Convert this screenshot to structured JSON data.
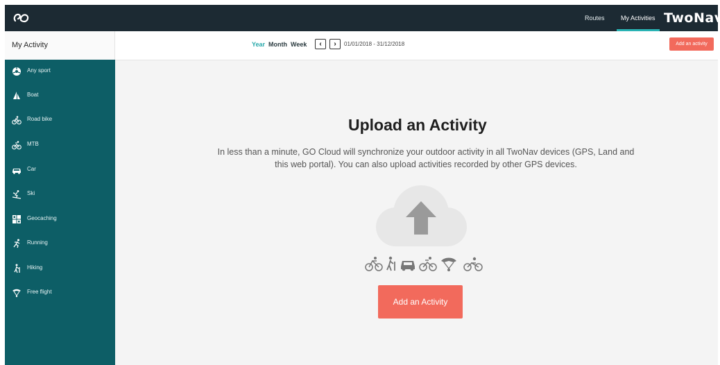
{
  "header": {
    "nav": [
      {
        "label": "Routes",
        "active": false
      },
      {
        "label": "My Activities",
        "active": true
      }
    ],
    "brand": "TwoNav",
    "logo_icon": "go-logo-icon"
  },
  "subheader": {
    "title": "My Activity",
    "periods": [
      {
        "label": "Year",
        "active": true
      },
      {
        "label": "Month",
        "active": false
      },
      {
        "label": "Week",
        "active": false
      }
    ],
    "prev_icon": "chevron-left-icon",
    "next_icon": "chevron-right-icon",
    "date_range": "01/01/2018 - 31/12/2018",
    "add_button": "Add an activity"
  },
  "sidebar": {
    "items": [
      {
        "label": "Any sport",
        "icon": "any-sport-icon"
      },
      {
        "label": "Boat",
        "icon": "boat-icon"
      },
      {
        "label": "Road bike",
        "icon": "road-bike-icon"
      },
      {
        "label": "MTB",
        "icon": "mtb-icon"
      },
      {
        "label": "Car",
        "icon": "car-icon"
      },
      {
        "label": "Ski",
        "icon": "ski-icon"
      },
      {
        "label": "Geocaching",
        "icon": "geocaching-icon"
      },
      {
        "label": "Running",
        "icon": "running-icon"
      },
      {
        "label": "Hiking",
        "icon": "hiking-icon"
      },
      {
        "label": "Free flight",
        "icon": "free-flight-icon"
      }
    ]
  },
  "main": {
    "title": "Upload an Activity",
    "description": "In less than a minute, GO Cloud will synchronize your outdoor activity in all TwoNav devices (GPS, Land and this web portal). You can also upload activities recorded by other GPS devices.",
    "upload_icon": "cloud-upload-icon",
    "activity_icons": [
      "road-bike-icon",
      "hiking-icon",
      "car-icon",
      "mtb-icon",
      "paraglider-icon",
      "motorbike-icon"
    ],
    "add_button": "Add an Activity"
  },
  "colors": {
    "topbar": "#1c2a33",
    "sidebar": "#0d5e66",
    "accent": "#29a9ab",
    "button": "#f26a5c"
  }
}
